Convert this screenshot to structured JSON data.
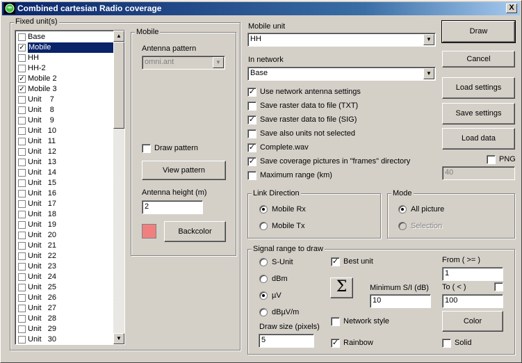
{
  "window": {
    "title": "Combined cartesian Radio coverage",
    "close_label": "X"
  },
  "fixed_units": {
    "label": "Fixed unit(s)",
    "items": [
      {
        "label": "Base",
        "checked": false
      },
      {
        "label": "Mobile",
        "checked": true,
        "selected": true
      },
      {
        "label": "HH",
        "checked": false
      },
      {
        "label": "HH-2",
        "checked": false
      },
      {
        "label": "Mobile 2",
        "checked": true
      },
      {
        "label": "Mobile 3",
        "checked": true
      },
      {
        "label": "Unit    7",
        "checked": false
      },
      {
        "label": "Unit    8",
        "checked": false
      },
      {
        "label": "Unit    9",
        "checked": false
      },
      {
        "label": "Unit   10",
        "checked": false
      },
      {
        "label": "Unit   11",
        "checked": false
      },
      {
        "label": "Unit   12",
        "checked": false
      },
      {
        "label": "Unit   13",
        "checked": false
      },
      {
        "label": "Unit   14",
        "checked": false
      },
      {
        "label": "Unit   15",
        "checked": false
      },
      {
        "label": "Unit   16",
        "checked": false
      },
      {
        "label": "Unit   17",
        "checked": false
      },
      {
        "label": "Unit   18",
        "checked": false
      },
      {
        "label": "Unit   19",
        "checked": false
      },
      {
        "label": "Unit   20",
        "checked": false
      },
      {
        "label": "Unit   21",
        "checked": false
      },
      {
        "label": "Unit   22",
        "checked": false
      },
      {
        "label": "Unit   23",
        "checked": false
      },
      {
        "label": "Unit   24",
        "checked": false
      },
      {
        "label": "Unit   25",
        "checked": false
      },
      {
        "label": "Unit   26",
        "checked": false
      },
      {
        "label": "Unit   27",
        "checked": false
      },
      {
        "label": "Unit   28",
        "checked": false
      },
      {
        "label": "Unit   29",
        "checked": false
      },
      {
        "label": "Unit   30",
        "checked": false
      }
    ]
  },
  "mobile": {
    "label": "Mobile",
    "antenna_pattern_label": "Antenna pattern",
    "antenna_pattern_value": "omni.ant",
    "draw_pattern_label": "Draw pattern",
    "draw_pattern_checked": false,
    "view_pattern_button": "View pattern",
    "antenna_height_label": "Antenna height (m)",
    "antenna_height_value": "2",
    "backcolor_button": "Backcolor",
    "backcolor": "#f08080"
  },
  "mobile_unit": {
    "label": "Mobile unit",
    "value": "HH"
  },
  "in_network": {
    "label": "In network",
    "value": "Base"
  },
  "options": [
    {
      "label": "Use network antenna settings",
      "checked": true
    },
    {
      "label": "Save raster data to file (TXT)",
      "checked": false
    },
    {
      "label": "Save raster data to file (SIG)",
      "checked": true
    },
    {
      "label": "Save also units not selected",
      "checked": false
    },
    {
      "label": "Complete.wav",
      "checked": true
    },
    {
      "label": "Save coverage pictures in \"frames\" directory",
      "checked": true
    },
    {
      "label": "Maximum range (km)",
      "checked": false
    }
  ],
  "buttons": {
    "draw": "Draw",
    "cancel": "Cancel",
    "load_settings": "Load settings",
    "save_settings": "Save settings",
    "load_data": "Load data"
  },
  "png": {
    "label": "PNG",
    "checked": false,
    "value": "40"
  },
  "link_direction": {
    "label": "Link Direction",
    "options": [
      {
        "label": "Mobile Rx",
        "selected": true
      },
      {
        "label": "Mobile Tx",
        "selected": false
      }
    ]
  },
  "mode": {
    "label": "Mode",
    "options": [
      {
        "label": "All picture",
        "selected": true
      },
      {
        "label": "Selection",
        "selected": false,
        "disabled": true
      }
    ]
  },
  "signal_range": {
    "label": "Signal range to draw",
    "units": [
      {
        "label": "S-Unit",
        "selected": false
      },
      {
        "label": "dBm",
        "selected": false
      },
      {
        "label": "µV",
        "selected": true
      },
      {
        "label": "dBµV/m",
        "selected": false
      }
    ],
    "draw_size_label": "Draw size (pixels)",
    "draw_size_value": "5",
    "best_unit_label": "Best unit",
    "best_unit_checked": true,
    "sigma_button": "Σ",
    "min_si_label": "Minimum S/I (dB)",
    "min_si_value": "10",
    "network_style_label": "Network style",
    "network_style_checked": false,
    "rainbow_label": "Rainbow",
    "rainbow_checked": true,
    "from_label": "From ( >= )",
    "from_value": "1",
    "to_label": "To ( < )",
    "to_checked": false,
    "to_value": "100",
    "color_button": "Color",
    "solid_label": "Solid",
    "solid_checked": false
  }
}
